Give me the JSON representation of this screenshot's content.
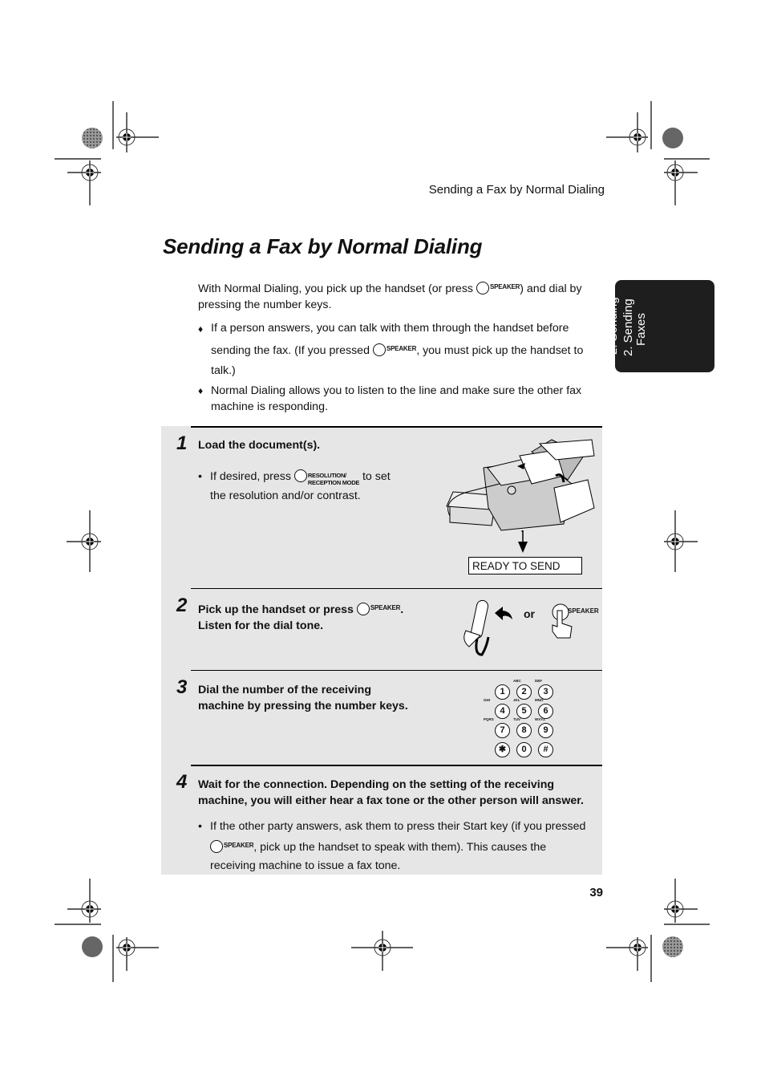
{
  "running_head": "Sending a Fax by Normal Dialing",
  "page_title": "Sending a Fax by Normal Dialing",
  "intro": {
    "before": "With Normal Dialing, you pick up the handset (or press ",
    "button": "SPEAKER",
    "after": ") and dial by pressing the number keys."
  },
  "bullets": [
    {
      "mark": "♦",
      "before": "If a person answers, you can talk with them through the handset before sending the fax. (If you pressed ",
      "button": "SPEAKER",
      "after": ", you must pick up the handset to talk.)"
    },
    {
      "mark": "♦",
      "text": "Normal Dialing allows you to listen to the line and make sure the other fax machine is responding."
    }
  ],
  "side_tab": {
    "line1": "2. Sending",
    "line2": "Faxes"
  },
  "steps": [
    {
      "number": "1",
      "text": "Load the document(s).",
      "bullet": {
        "mark": "•",
        "before": "If desired, press ",
        "button_line1": "RESOLUTION/",
        "button_line2": "RECEPTION MODE",
        "after": " to set the resolution and/or contrast."
      },
      "display": "READY TO SEND"
    },
    {
      "number": "2",
      "line1_before": "Pick up the handset or press ",
      "button": "SPEAKER",
      "line1_after": ".",
      "line2": "Listen for the dial tone.",
      "or_label": "or",
      "illustration_button": "SPEAKER"
    },
    {
      "number": "3",
      "line1": "Dial the number of the receiving",
      "line2": "machine by pressing the number keys.",
      "keypad": [
        {
          "key": "1",
          "sub": ""
        },
        {
          "key": "2",
          "sub": "ABC"
        },
        {
          "key": "3",
          "sub": "DEF"
        },
        {
          "key": "4",
          "sub": "GHI"
        },
        {
          "key": "5",
          "sub": "JKL"
        },
        {
          "key": "6",
          "sub": "MNO"
        },
        {
          "key": "7",
          "sub": "PQRS"
        },
        {
          "key": "8",
          "sub": "TUV"
        },
        {
          "key": "9",
          "sub": "WXYZ"
        },
        {
          "key": "✱",
          "sub": ""
        },
        {
          "key": "0",
          "sub": ""
        },
        {
          "key": "#",
          "sub": ""
        }
      ]
    },
    {
      "number": "4",
      "line1": "Wait for the connection. Depending on the setting of the receiving",
      "line2": "machine, you will either hear a fax tone or the other person will answer.",
      "bullet": {
        "mark": "•",
        "line1": "If the other party answers, ask them to press their Start key (if you pressed",
        "button": "SPEAKER",
        "line2_after": ", pick up the handset to speak with them). This causes the",
        "line3": "receiving machine to issue a fax tone."
      }
    }
  ],
  "page_number": "39"
}
